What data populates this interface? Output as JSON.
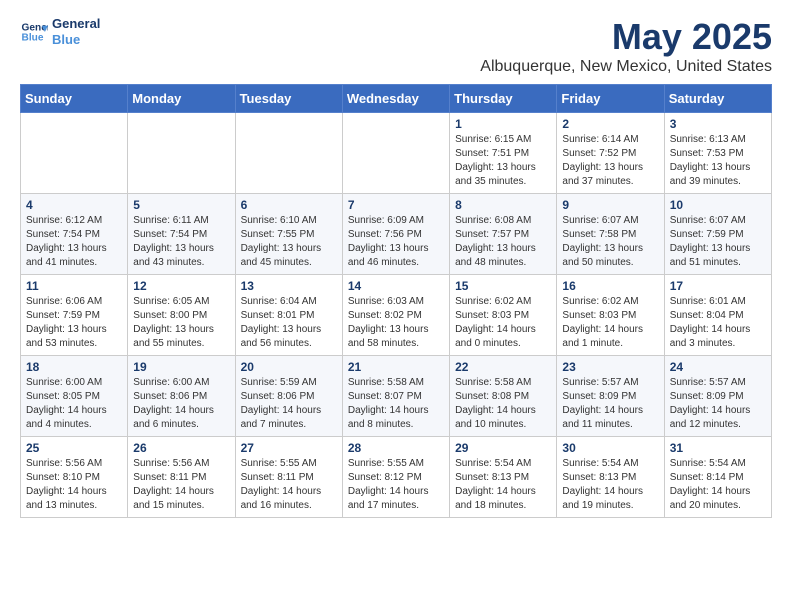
{
  "logo": {
    "line1": "General",
    "line2": "Blue"
  },
  "title": "May 2025",
  "subtitle": "Albuquerque, New Mexico, United States",
  "weekdays": [
    "Sunday",
    "Monday",
    "Tuesday",
    "Wednesday",
    "Thursday",
    "Friday",
    "Saturday"
  ],
  "weeks": [
    [
      {
        "day": "",
        "info": ""
      },
      {
        "day": "",
        "info": ""
      },
      {
        "day": "",
        "info": ""
      },
      {
        "day": "",
        "info": ""
      },
      {
        "day": "1",
        "info": "Sunrise: 6:15 AM\nSunset: 7:51 PM\nDaylight: 13 hours\nand 35 minutes."
      },
      {
        "day": "2",
        "info": "Sunrise: 6:14 AM\nSunset: 7:52 PM\nDaylight: 13 hours\nand 37 minutes."
      },
      {
        "day": "3",
        "info": "Sunrise: 6:13 AM\nSunset: 7:53 PM\nDaylight: 13 hours\nand 39 minutes."
      }
    ],
    [
      {
        "day": "4",
        "info": "Sunrise: 6:12 AM\nSunset: 7:54 PM\nDaylight: 13 hours\nand 41 minutes."
      },
      {
        "day": "5",
        "info": "Sunrise: 6:11 AM\nSunset: 7:54 PM\nDaylight: 13 hours\nand 43 minutes."
      },
      {
        "day": "6",
        "info": "Sunrise: 6:10 AM\nSunset: 7:55 PM\nDaylight: 13 hours\nand 45 minutes."
      },
      {
        "day": "7",
        "info": "Sunrise: 6:09 AM\nSunset: 7:56 PM\nDaylight: 13 hours\nand 46 minutes."
      },
      {
        "day": "8",
        "info": "Sunrise: 6:08 AM\nSunset: 7:57 PM\nDaylight: 13 hours\nand 48 minutes."
      },
      {
        "day": "9",
        "info": "Sunrise: 6:07 AM\nSunset: 7:58 PM\nDaylight: 13 hours\nand 50 minutes."
      },
      {
        "day": "10",
        "info": "Sunrise: 6:07 AM\nSunset: 7:59 PM\nDaylight: 13 hours\nand 51 minutes."
      }
    ],
    [
      {
        "day": "11",
        "info": "Sunrise: 6:06 AM\nSunset: 7:59 PM\nDaylight: 13 hours\nand 53 minutes."
      },
      {
        "day": "12",
        "info": "Sunrise: 6:05 AM\nSunset: 8:00 PM\nDaylight: 13 hours\nand 55 minutes."
      },
      {
        "day": "13",
        "info": "Sunrise: 6:04 AM\nSunset: 8:01 PM\nDaylight: 13 hours\nand 56 minutes."
      },
      {
        "day": "14",
        "info": "Sunrise: 6:03 AM\nSunset: 8:02 PM\nDaylight: 13 hours\nand 58 minutes."
      },
      {
        "day": "15",
        "info": "Sunrise: 6:02 AM\nSunset: 8:03 PM\nDaylight: 14 hours\nand 0 minutes."
      },
      {
        "day": "16",
        "info": "Sunrise: 6:02 AM\nSunset: 8:03 PM\nDaylight: 14 hours\nand 1 minute."
      },
      {
        "day": "17",
        "info": "Sunrise: 6:01 AM\nSunset: 8:04 PM\nDaylight: 14 hours\nand 3 minutes."
      }
    ],
    [
      {
        "day": "18",
        "info": "Sunrise: 6:00 AM\nSunset: 8:05 PM\nDaylight: 14 hours\nand 4 minutes."
      },
      {
        "day": "19",
        "info": "Sunrise: 6:00 AM\nSunset: 8:06 PM\nDaylight: 14 hours\nand 6 minutes."
      },
      {
        "day": "20",
        "info": "Sunrise: 5:59 AM\nSunset: 8:06 PM\nDaylight: 14 hours\nand 7 minutes."
      },
      {
        "day": "21",
        "info": "Sunrise: 5:58 AM\nSunset: 8:07 PM\nDaylight: 14 hours\nand 8 minutes."
      },
      {
        "day": "22",
        "info": "Sunrise: 5:58 AM\nSunset: 8:08 PM\nDaylight: 14 hours\nand 10 minutes."
      },
      {
        "day": "23",
        "info": "Sunrise: 5:57 AM\nSunset: 8:09 PM\nDaylight: 14 hours\nand 11 minutes."
      },
      {
        "day": "24",
        "info": "Sunrise: 5:57 AM\nSunset: 8:09 PM\nDaylight: 14 hours\nand 12 minutes."
      }
    ],
    [
      {
        "day": "25",
        "info": "Sunrise: 5:56 AM\nSunset: 8:10 PM\nDaylight: 14 hours\nand 13 minutes."
      },
      {
        "day": "26",
        "info": "Sunrise: 5:56 AM\nSunset: 8:11 PM\nDaylight: 14 hours\nand 15 minutes."
      },
      {
        "day": "27",
        "info": "Sunrise: 5:55 AM\nSunset: 8:11 PM\nDaylight: 14 hours\nand 16 minutes."
      },
      {
        "day": "28",
        "info": "Sunrise: 5:55 AM\nSunset: 8:12 PM\nDaylight: 14 hours\nand 17 minutes."
      },
      {
        "day": "29",
        "info": "Sunrise: 5:54 AM\nSunset: 8:13 PM\nDaylight: 14 hours\nand 18 minutes."
      },
      {
        "day": "30",
        "info": "Sunrise: 5:54 AM\nSunset: 8:13 PM\nDaylight: 14 hours\nand 19 minutes."
      },
      {
        "day": "31",
        "info": "Sunrise: 5:54 AM\nSunset: 8:14 PM\nDaylight: 14 hours\nand 20 minutes."
      }
    ]
  ]
}
